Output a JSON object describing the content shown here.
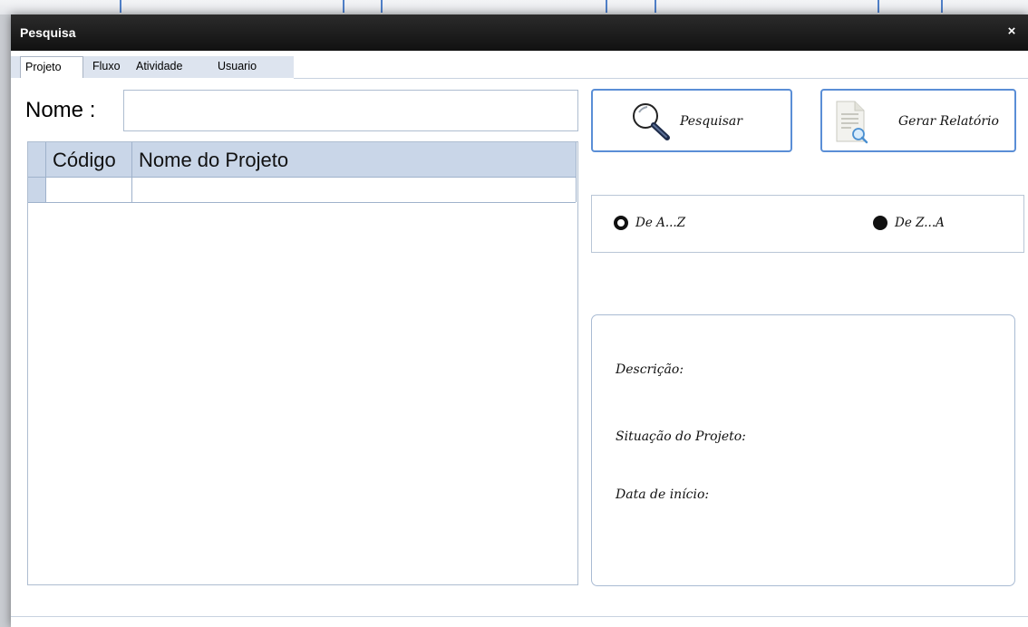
{
  "window": {
    "title": "Pesquisa",
    "close_label": "×"
  },
  "tabs": [
    {
      "label": "Projeto",
      "active": true
    },
    {
      "label": "Fluxo",
      "active": false
    },
    {
      "label": "Atividade",
      "active": false
    },
    {
      "label": "Usuario",
      "active": false
    }
  ],
  "search": {
    "label": "Nome :",
    "value": "",
    "placeholder": ""
  },
  "grid": {
    "columns": [
      "Código",
      "Nome do Projeto"
    ],
    "rows": [
      {
        "codigo": "",
        "nome": ""
      }
    ]
  },
  "buttons": {
    "search_label": "Pesquisar",
    "report_label": "Gerar Relatório"
  },
  "sort": {
    "options": [
      {
        "label": "De A...Z",
        "selected": true
      },
      {
        "label": "De Z...A",
        "selected": false
      }
    ]
  },
  "details": {
    "descricao_label": "Descrição:",
    "situacao_label": "Situação do Projeto:",
    "data_label": "Data de início:"
  },
  "colors": {
    "accent": "#5a8ed6",
    "titlebar": "#111111",
    "grid_header": "#c9d6e8"
  },
  "icons": {
    "search_button": "magnifier-icon",
    "report_button": "document-search-icon",
    "close": "close-icon"
  }
}
